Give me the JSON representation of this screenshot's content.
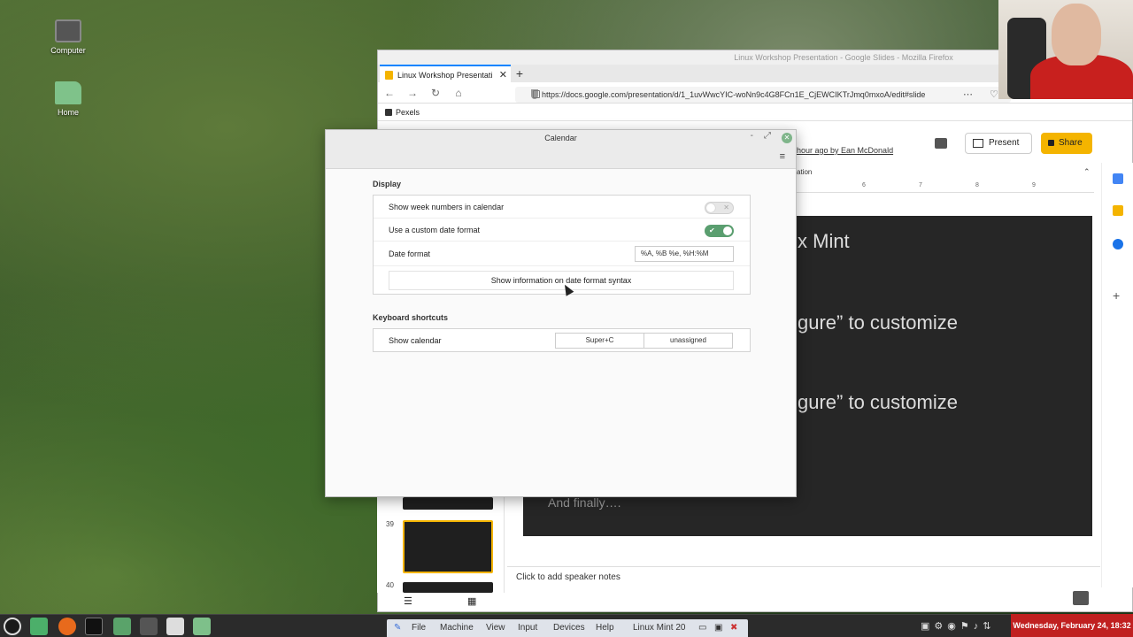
{
  "desktop": {
    "icons": [
      {
        "label": "Computer"
      },
      {
        "label": "Home"
      }
    ]
  },
  "firefox": {
    "window_title": "Linux Workshop Presentation - Google Slides - Mozilla Firefox",
    "tab_title": "Linux Workshop Presentati",
    "url": "https://docs.google.com/presentation/d/1_1uvWwcYIC-woNn9c4G8FCn1E_CjEWCIKTrJmq0mxoA/edit#slide",
    "bookmark": "Pexels"
  },
  "slides": {
    "present_label": "Present",
    "share_label": "Share",
    "last_edit": "hour ago by Ean McDonald",
    "section_label": "ation",
    "ruler_ticks": [
      "6",
      "7",
      "8",
      "9"
    ],
    "slide_lines": [
      "x Mint",
      "gure” to customize",
      "gure” to customize"
    ],
    "slide_footer": "And finally….",
    "thumb_numbers": [
      "39",
      "40"
    ],
    "notes_placeholder": "Click to add speaker notes"
  },
  "calendar": {
    "title": "Calendar",
    "display_heading": "Display",
    "rows": {
      "week_numbers": {
        "label": "Show week numbers in calendar",
        "enabled": false
      },
      "custom_format": {
        "label": "Use a custom date format",
        "enabled": true
      },
      "date_format": {
        "label": "Date format",
        "value": "%A, %B %e, %H:%M"
      },
      "info_button": "Show information on date format syntax"
    },
    "shortcuts_heading": "Keyboard shortcuts",
    "shortcut": {
      "label": "Show calendar",
      "primary": "Super+C",
      "secondary": "unassigned"
    }
  },
  "vbox_menu": {
    "items": [
      "File",
      "Machine",
      "View",
      "Input",
      "Devices",
      "Help"
    ],
    "machine_name": "Linux Mint 20"
  },
  "clock": "Wednesday, February 24, 18:32",
  "colors": {
    "switch_on": "#5a9e6f",
    "share_button": "#f4b400",
    "clock_bg": "#c02020"
  }
}
